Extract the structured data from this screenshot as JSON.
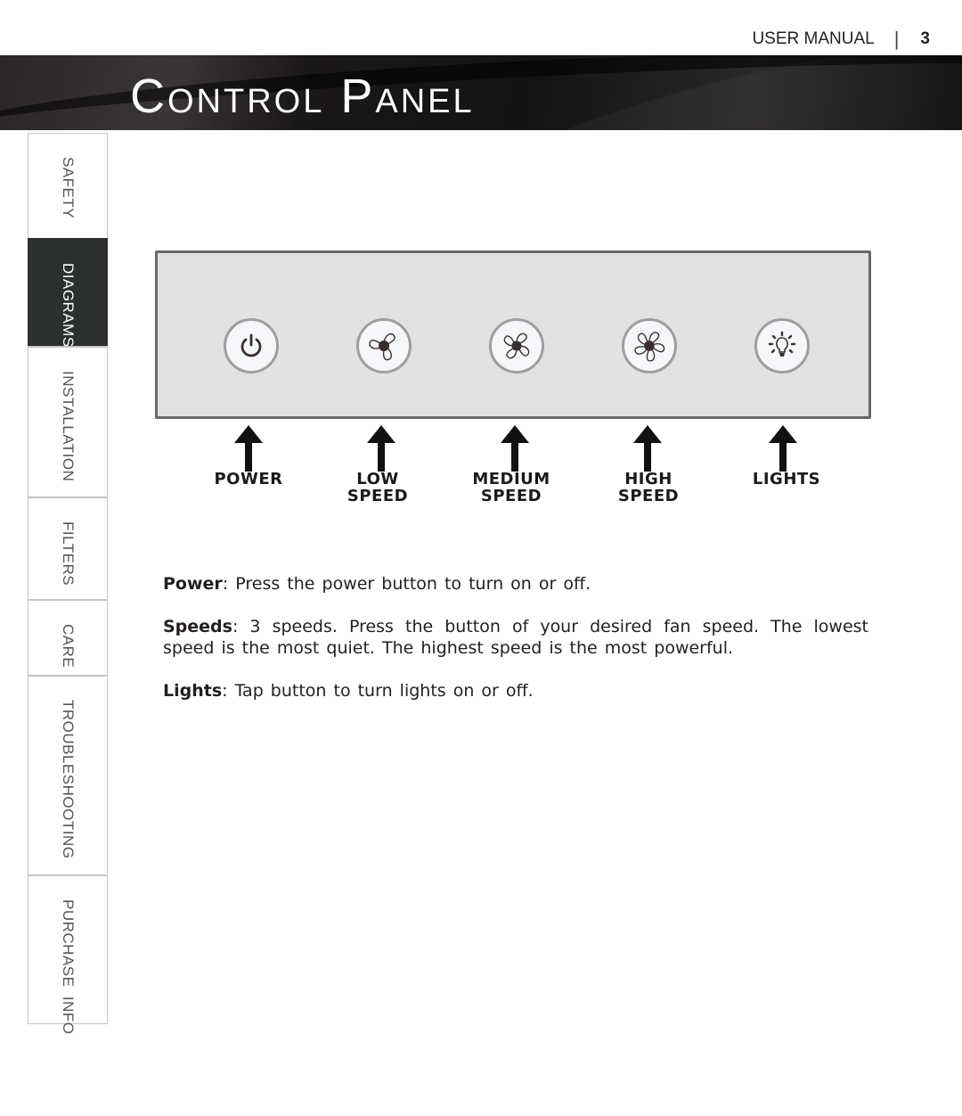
{
  "header": {
    "doc_label": "USER MANUAL",
    "separator": "|",
    "page_number": "3"
  },
  "title": "Control Panel",
  "sidebar": {
    "active": "DIAGRAMS",
    "tabs": [
      {
        "label": "SAFETY"
      },
      {
        "label": "DIAGRAMS"
      },
      {
        "label": "INSTALLATION"
      },
      {
        "label": "FILTERS"
      },
      {
        "label": "CARE"
      },
      {
        "label": "TROUBLESHOOTING"
      },
      {
        "label": "PURCHASE  INFO"
      }
    ]
  },
  "panel": {
    "buttons": [
      {
        "icon": "power-icon",
        "label_line1": "POWER",
        "label_line2": ""
      },
      {
        "icon": "fan-low-icon",
        "label_line1": "LOW",
        "label_line2": "SPEED"
      },
      {
        "icon": "fan-medium-icon",
        "label_line1": "MEDIUM",
        "label_line2": "SPEED"
      },
      {
        "icon": "fan-high-icon",
        "label_line1": "HIGH",
        "label_line2": "SPEED"
      },
      {
        "icon": "light-bulb-icon",
        "label_line1": "LIGHTS",
        "label_line2": ""
      }
    ],
    "colors": {
      "panel_bg": "#e2e2e2",
      "panel_border": "#6a6868",
      "button_bg": "#f6f7fa",
      "icon": "#3a2e2b"
    }
  },
  "descriptions": [
    {
      "term": "Power",
      "text": " Press the power button to turn on or off."
    },
    {
      "term": "Speeds",
      "text": " 3 speeds. Press the button of your desired fan speed. The lowest speed is the most quiet. The highest speed is the most powerful."
    },
    {
      "term": "Lights",
      "text": " Tap button to turn lights on or off."
    }
  ]
}
